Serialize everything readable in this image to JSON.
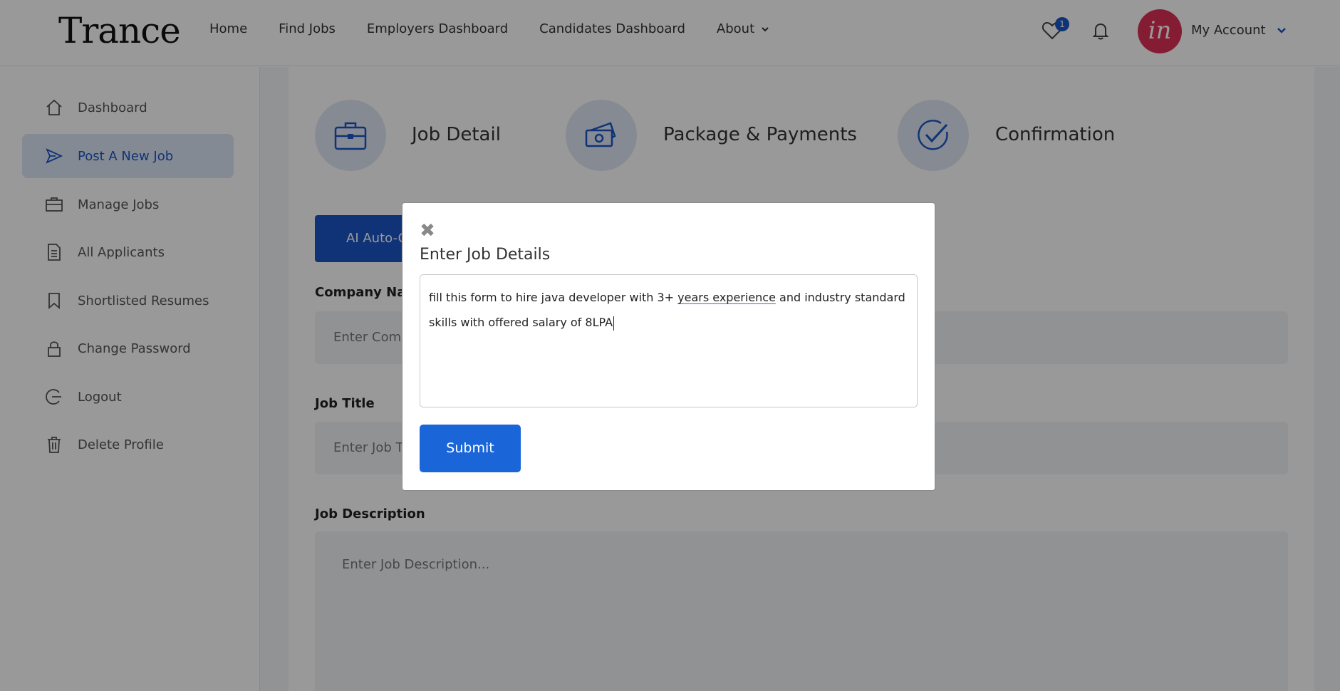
{
  "header": {
    "logo": "Trance",
    "nav": [
      {
        "label": "Home"
      },
      {
        "label": "Find Jobs"
      },
      {
        "label": "Employers Dashboard"
      },
      {
        "label": "Candidates Dashboard"
      },
      {
        "label": "About"
      }
    ],
    "wishlist_count": "1",
    "avatar_text": "in",
    "account_label": "My Account"
  },
  "sidebar": {
    "items": [
      {
        "label": "Dashboard",
        "icon": "home-icon"
      },
      {
        "label": "Post A New Job",
        "icon": "send-icon",
        "active": true
      },
      {
        "label": "Manage Jobs",
        "icon": "briefcase-icon"
      },
      {
        "label": "All Applicants",
        "icon": "document-icon"
      },
      {
        "label": "Shortlisted Resumes",
        "icon": "bookmark-icon"
      },
      {
        "label": "Change Password",
        "icon": "lock-icon"
      },
      {
        "label": "Logout",
        "icon": "logout-icon"
      },
      {
        "label": "Delete Profile",
        "icon": "trash-icon"
      }
    ]
  },
  "steps": [
    {
      "label": "Job Detail",
      "icon": "briefcase-icon"
    },
    {
      "label": "Package & Payments",
      "icon": "money-icon"
    },
    {
      "label": "Confirmation",
      "icon": "check-icon"
    }
  ],
  "form": {
    "ai_button": "AI Auto-G",
    "company_label": "Company Nam",
    "company_placeholder": "Enter Comp",
    "job_title_label": "Job Title",
    "job_title_placeholder": "Enter Job Tit",
    "job_desc_label": "Job Description",
    "job_desc_placeholder": "Enter Job Description..."
  },
  "modal": {
    "title": "Enter Job Details",
    "text_before": "fill this form to hire java developer with 3+ ",
    "text_underlined": "years experience",
    "text_after": " and industry standard skills with offered salary of 8LPA",
    "submit_label": "Submit"
  },
  "colors": {
    "accent": "#1a56c5",
    "submit": "#1a66d9",
    "avatar": "#dc3058",
    "active_bg": "#dce6f5"
  }
}
